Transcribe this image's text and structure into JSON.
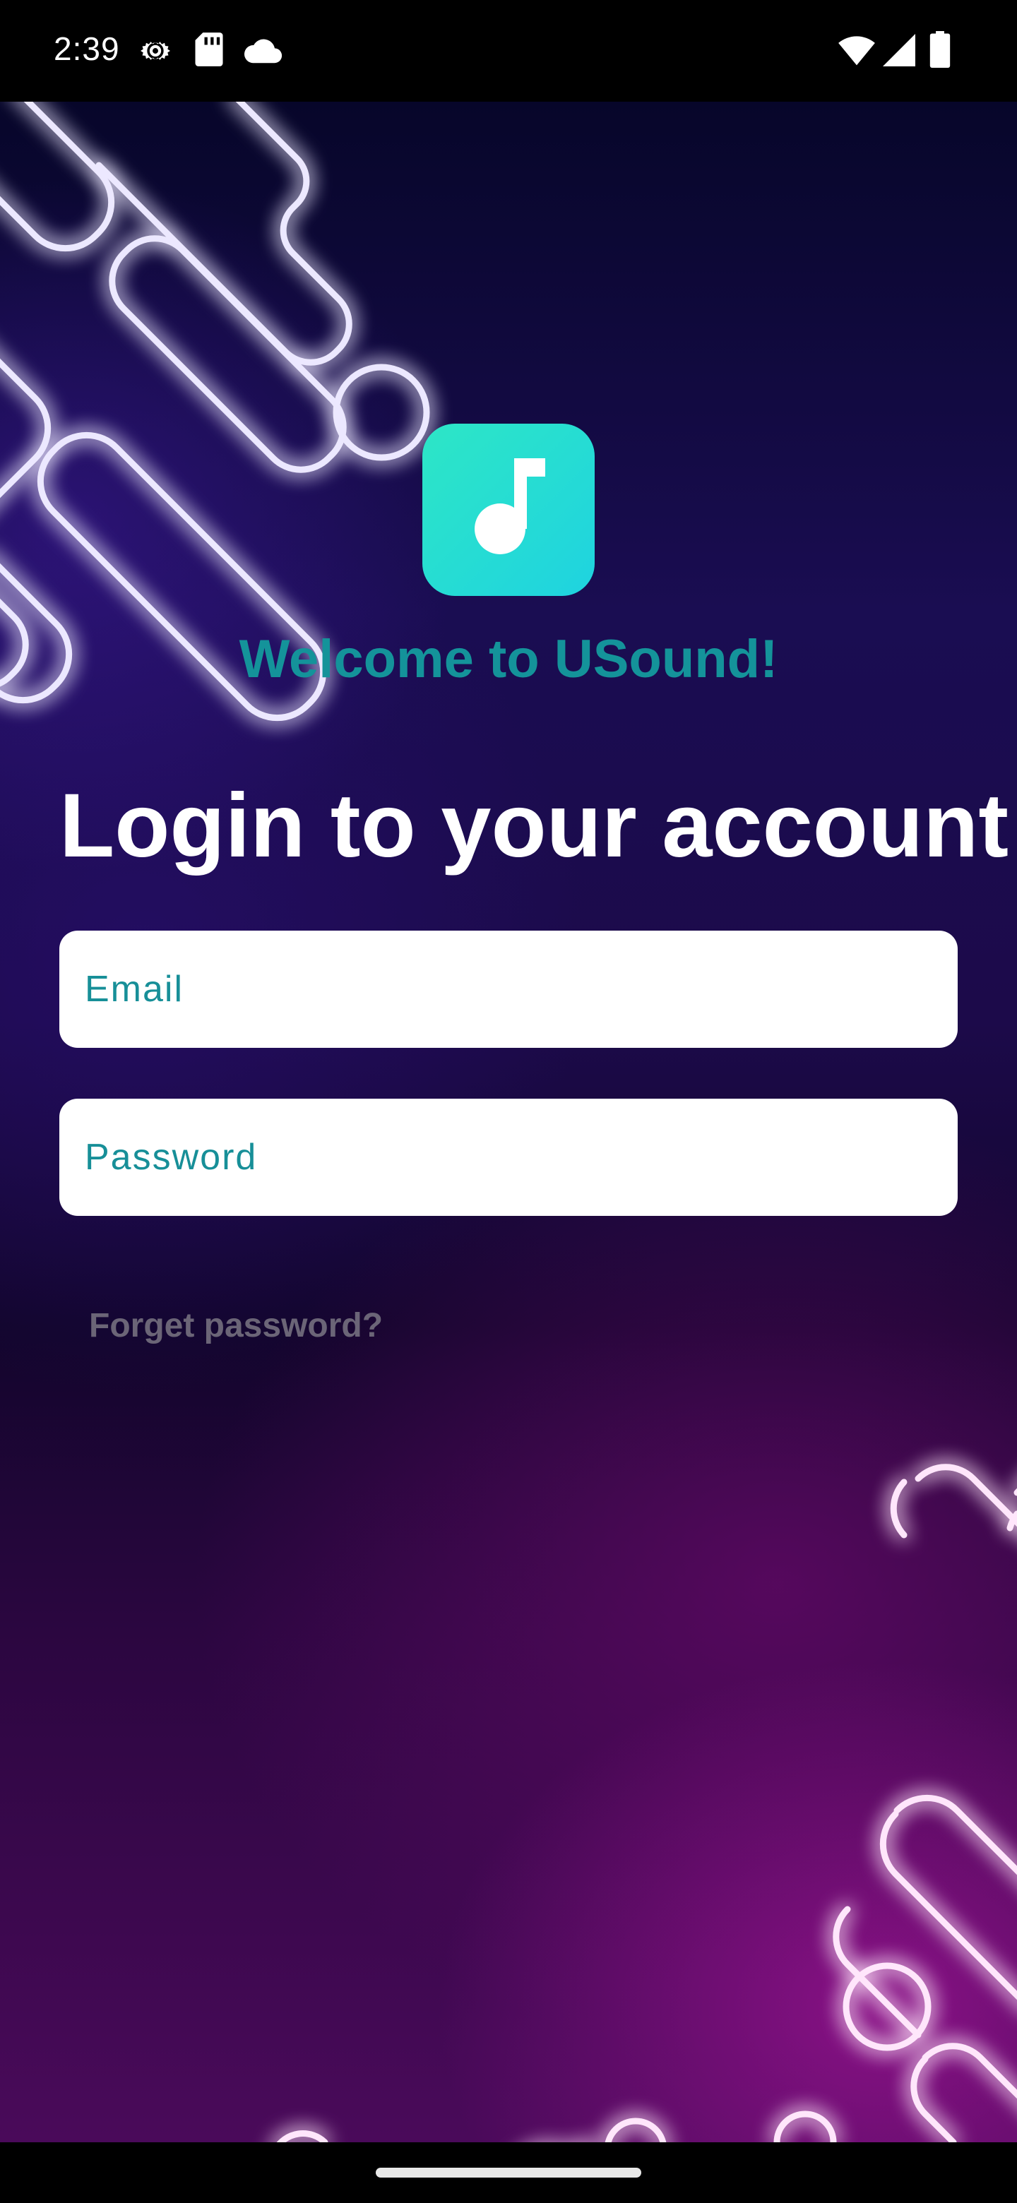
{
  "status_bar": {
    "time": "2:39",
    "left_icons": [
      "settings-gear-icon",
      "sd-card-icon",
      "cloud-icon"
    ],
    "right_icons": [
      "wifi-icon",
      "cell-signal-icon",
      "battery-icon"
    ]
  },
  "app": {
    "logo_icon": "music-note-icon",
    "welcome_text": "Welcome to USound!",
    "accent_color": "#14939a",
    "logo_gradient": [
      "#2de6c6",
      "#1fd3e0"
    ]
  },
  "login": {
    "title": "Login to your account",
    "email_placeholder": "Email",
    "password_placeholder": "Password",
    "forgot_password": "Forget password?"
  }
}
